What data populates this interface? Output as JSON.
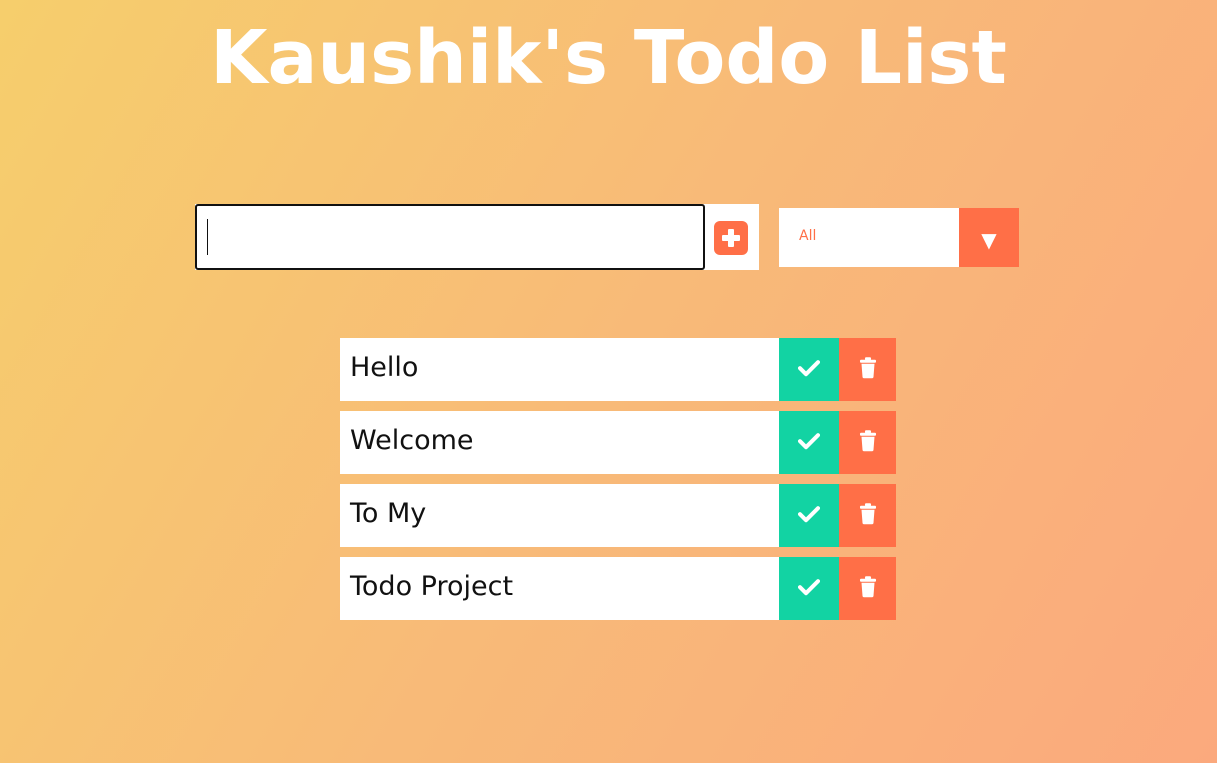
{
  "header": {
    "title": "Kaushik's Todo List"
  },
  "form": {
    "input_value": "",
    "input_placeholder": "",
    "add_button_icon": "plus-square-icon",
    "filter_selected": "All",
    "filter_arrow_glyph": "▼"
  },
  "todos": [
    {
      "text": "Hello"
    },
    {
      "text": "Welcome"
    },
    {
      "text": "To My"
    },
    {
      "text": "Todo Project"
    }
  ],
  "colors": {
    "accent": "#ff6f47",
    "complete": "#12d3a3",
    "title": "#ffffff",
    "background_start": "#f6ce6c",
    "background_end": "#fba97d"
  },
  "icons": {
    "complete": "check-icon",
    "delete": "trash-icon",
    "filter": "chevron-down-icon"
  }
}
